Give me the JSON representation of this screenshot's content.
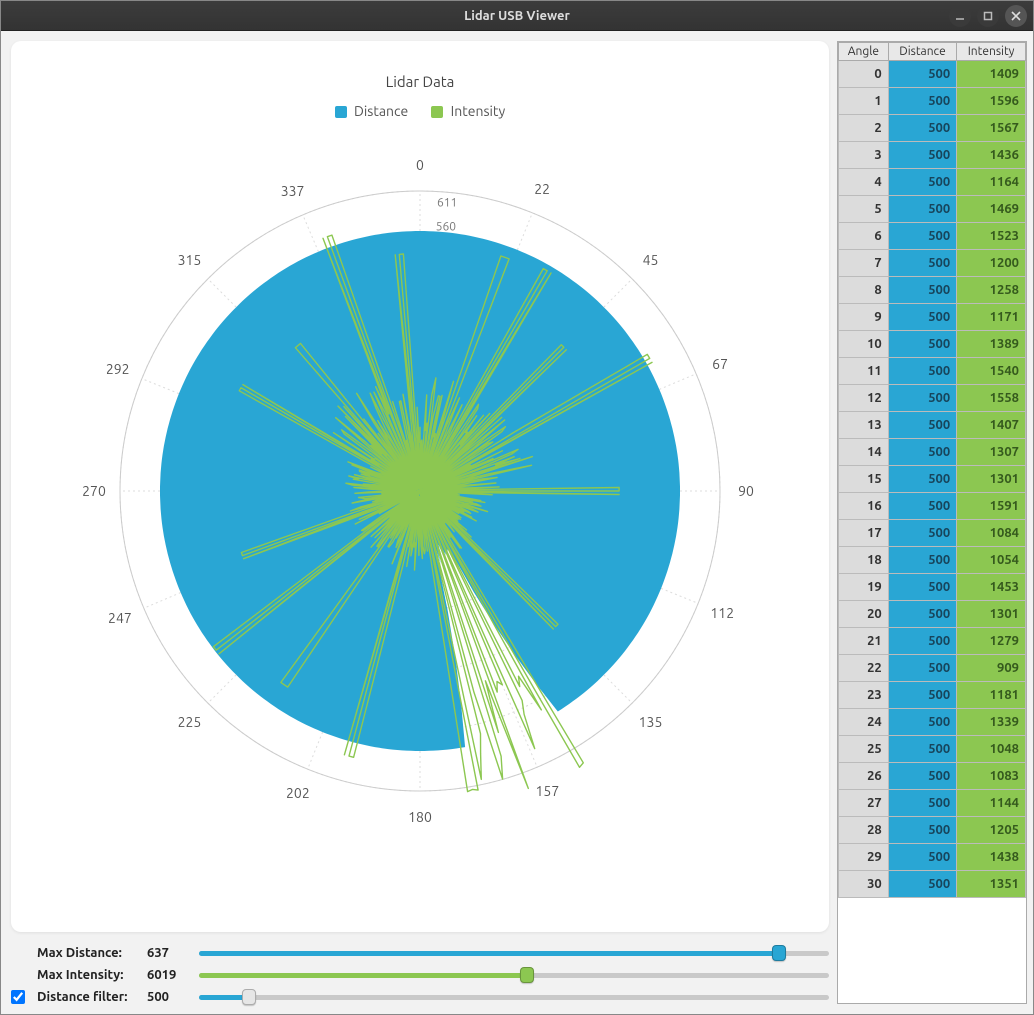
{
  "window": {
    "title": "Lidar USB Viewer"
  },
  "chart": {
    "title": "Lidar Data",
    "legend": [
      {
        "name": "Distance",
        "color": "#29a6d4"
      },
      {
        "name": "Intensity",
        "color": "#8cc751"
      }
    ],
    "axis_values": [
      "611",
      "560"
    ]
  },
  "controls": {
    "max_distance": {
      "label": "Max Distance:",
      "value": "637",
      "pct": 92,
      "color": "#29a6d4"
    },
    "max_intensity": {
      "label": "Max Intensity:",
      "value": "6019",
      "pct": 52,
      "color": "#8cc751"
    },
    "distance_filter": {
      "label": "Distance filter:",
      "value": "500",
      "pct": 8,
      "color": "#29a6d4",
      "checked": true
    }
  },
  "colors": {
    "distance": "#29a6d4",
    "intensity": "#8cc751",
    "angle_cell": "#d6d6d6"
  },
  "table": {
    "headers": [
      "Angle",
      "Distance",
      "Intensity"
    ],
    "rows": [
      {
        "a": 0,
        "d": 500,
        "i": 1409
      },
      {
        "a": 1,
        "d": 500,
        "i": 1596
      },
      {
        "a": 2,
        "d": 500,
        "i": 1567
      },
      {
        "a": 3,
        "d": 500,
        "i": 1436
      },
      {
        "a": 4,
        "d": 500,
        "i": 1164
      },
      {
        "a": 5,
        "d": 500,
        "i": 1469
      },
      {
        "a": 6,
        "d": 500,
        "i": 1523
      },
      {
        "a": 7,
        "d": 500,
        "i": 1200
      },
      {
        "a": 8,
        "d": 500,
        "i": 1258
      },
      {
        "a": 9,
        "d": 500,
        "i": 1171
      },
      {
        "a": 10,
        "d": 500,
        "i": 1389
      },
      {
        "a": 11,
        "d": 500,
        "i": 1540
      },
      {
        "a": 12,
        "d": 500,
        "i": 1558
      },
      {
        "a": 13,
        "d": 500,
        "i": 1407
      },
      {
        "a": 14,
        "d": 500,
        "i": 1307
      },
      {
        "a": 15,
        "d": 500,
        "i": 1301
      },
      {
        "a": 16,
        "d": 500,
        "i": 1591
      },
      {
        "a": 17,
        "d": 500,
        "i": 1084
      },
      {
        "a": 18,
        "d": 500,
        "i": 1054
      },
      {
        "a": 19,
        "d": 500,
        "i": 1453
      },
      {
        "a": 20,
        "d": 500,
        "i": 1301
      },
      {
        "a": 21,
        "d": 500,
        "i": 1279
      },
      {
        "a": 22,
        "d": 500,
        "i": 909
      },
      {
        "a": 23,
        "d": 500,
        "i": 1181
      },
      {
        "a": 24,
        "d": 500,
        "i": 1339
      },
      {
        "a": 25,
        "d": 500,
        "i": 1048
      },
      {
        "a": 26,
        "d": 500,
        "i": 1083
      },
      {
        "a": 27,
        "d": 500,
        "i": 1144
      },
      {
        "a": 28,
        "d": 500,
        "i": 1205
      },
      {
        "a": 29,
        "d": 500,
        "i": 1438
      },
      {
        "a": 30,
        "d": 500,
        "i": 1351
      }
    ]
  },
  "chart_data": {
    "type": "polar",
    "title": "Lidar Data",
    "angle_ticks": [
      0,
      22,
      45,
      67,
      90,
      112,
      135,
      157,
      180,
      202,
      225,
      247,
      270,
      292,
      315,
      337
    ],
    "radial_ticks": [
      560,
      611
    ],
    "radial_max": 637,
    "series": [
      {
        "name": "Distance",
        "color": "#29a6d4",
        "angles_deg": [
          0,
          1,
          2,
          3,
          4,
          5,
          6,
          7,
          8,
          9,
          10,
          11,
          12,
          13,
          14,
          15,
          16,
          17,
          18,
          19,
          20,
          21,
          22,
          23,
          24,
          25,
          26,
          27,
          28,
          29,
          30
        ],
        "values": [
          500,
          500,
          500,
          500,
          500,
          500,
          500,
          500,
          500,
          500,
          500,
          500,
          500,
          500,
          500,
          500,
          500,
          500,
          500,
          500,
          500,
          500,
          500,
          500,
          500,
          500,
          500,
          500,
          500,
          500,
          500
        ],
        "note": "Most angles at 500; visible notch near 145–165° where distance drops toward ~0–300"
      },
      {
        "name": "Intensity",
        "color": "#8cc751",
        "angles_deg": [
          0,
          1,
          2,
          3,
          4,
          5,
          6,
          7,
          8,
          9,
          10,
          11,
          12,
          13,
          14,
          15,
          16,
          17,
          18,
          19,
          20,
          21,
          22,
          23,
          24,
          25,
          26,
          27,
          28,
          29,
          30
        ],
        "values": [
          1409,
          1596,
          1567,
          1436,
          1164,
          1469,
          1523,
          1200,
          1258,
          1171,
          1389,
          1540,
          1558,
          1407,
          1307,
          1301,
          1591,
          1084,
          1054,
          1453,
          1301,
          1279,
          909,
          1181,
          1339,
          1048,
          1083,
          1144,
          1205,
          1438,
          1351
        ],
        "note": "Irregular radial spikes; range approx 0–6019"
      }
    ]
  }
}
